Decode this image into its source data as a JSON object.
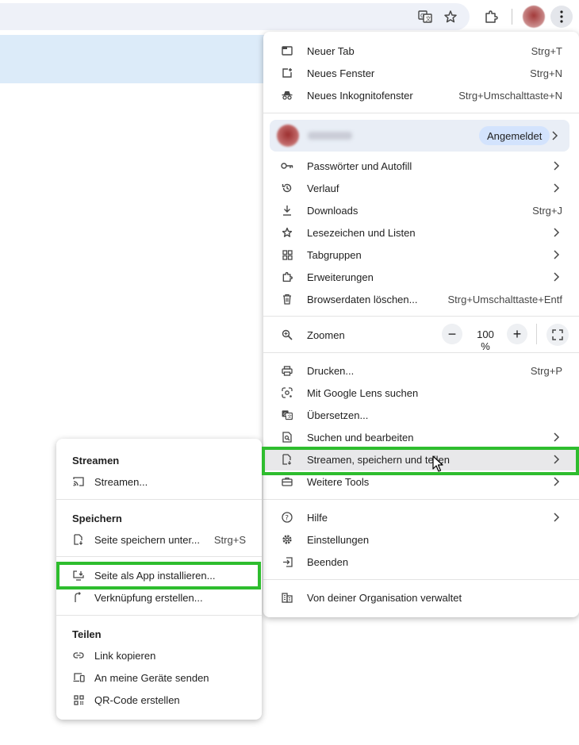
{
  "menu": {
    "items": [
      {
        "label": "Neuer Tab",
        "shortcut": "Strg+T",
        "icon": "new-tab-icon"
      },
      {
        "label": "Neues Fenster",
        "shortcut": "Strg+N",
        "icon": "new-window-icon"
      },
      {
        "label": "Neues Inkognitofenster",
        "shortcut": "Strg+Umschalttaste+N",
        "icon": "incognito-icon"
      }
    ],
    "profile": {
      "status": "Angemeldet"
    },
    "items2": [
      {
        "label": "Passwörter und Autofill",
        "icon": "key-icon"
      },
      {
        "label": "Verlauf",
        "icon": "history-icon"
      },
      {
        "label": "Downloads",
        "shortcut": "Strg+J",
        "icon": "download-icon"
      },
      {
        "label": "Lesezeichen und Listen",
        "icon": "star-icon"
      },
      {
        "label": "Tabgruppen",
        "icon": "tab-groups-icon"
      },
      {
        "label": "Erweiterungen",
        "icon": "extensions-icon"
      },
      {
        "label": "Browserdaten löschen...",
        "shortcut": "Strg+Umschalttaste+Entf",
        "icon": "trash-icon"
      }
    ],
    "zoom": {
      "label": "Zoomen",
      "value": "100 %",
      "minus": "−",
      "plus": "+"
    },
    "items3": [
      {
        "label": "Drucken...",
        "shortcut": "Strg+P",
        "icon": "print-icon"
      },
      {
        "label": "Mit Google Lens suchen",
        "icon": "lens-icon"
      },
      {
        "label": "Übersetzen...",
        "icon": "translate-icon"
      },
      {
        "label": "Suchen und bearbeiten",
        "icon": "find-icon"
      },
      {
        "label": "Streamen, speichern und teilen",
        "icon": "cast-save-icon"
      },
      {
        "label": "Weitere Tools",
        "icon": "toolbox-icon"
      }
    ],
    "items4": [
      {
        "label": "Hilfe",
        "icon": "help-icon"
      },
      {
        "label": "Einstellungen",
        "icon": "gear-icon"
      },
      {
        "label": "Beenden",
        "icon": "exit-icon"
      }
    ],
    "managed": {
      "label": "Von deiner Organisation verwaltet",
      "icon": "building-icon"
    }
  },
  "submenu": {
    "stream_header": "Streamen",
    "stream_item": "Streamen...",
    "save_header": "Speichern",
    "save_page": "Seite speichern unter...",
    "save_page_shortcut": "Strg+S",
    "install_app": "Seite als App installieren...",
    "create_shortcut": "Verknüpfung erstellen...",
    "share_header": "Teilen",
    "copy_link": "Link kopieren",
    "send_devices": "An meine Geräte senden",
    "qr_code": "QR-Code erstellen"
  },
  "colors": {
    "highlight": "#2ebd2e",
    "badge": "#d3e3fd"
  }
}
